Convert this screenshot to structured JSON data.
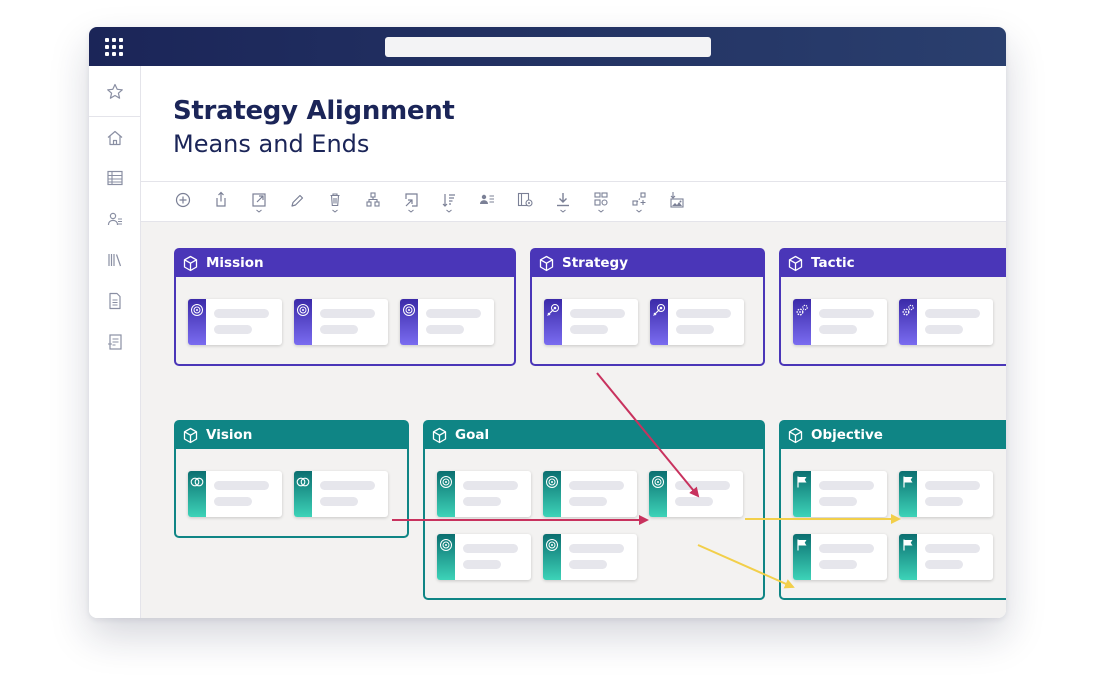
{
  "app": {
    "title": "Strategy Alignment",
    "subtitle": "Means and Ends"
  },
  "sidebar": {
    "items": [
      {
        "icon": "star-icon"
      },
      {
        "icon": "home-icon"
      },
      {
        "icon": "table-icon"
      },
      {
        "icon": "users-icon"
      },
      {
        "icon": "library-icon"
      },
      {
        "icon": "document-icon"
      },
      {
        "icon": "report-icon"
      }
    ]
  },
  "toolbar": {
    "tools": [
      "add-icon",
      "share-icon",
      "open-external-icon",
      "edit-icon",
      "delete-icon",
      "hierarchy-icon",
      "link-icon",
      "sort-icon",
      "assign-users-icon",
      "settings-panel-icon",
      "download-icon",
      "layout-icon",
      "connect-icon",
      "image-export-icon"
    ]
  },
  "colors": {
    "purple": "#4a36b8",
    "teal": "#0f8585",
    "crimson_arrow": "#c8325e",
    "yellow_arrow": "#f2cf4a",
    "navy": "#1b2558"
  },
  "groups": {
    "mission": {
      "label": "Mission",
      "card_icon": "target-icon"
    },
    "strategy": {
      "label": "Strategy",
      "card_icon": "rocket-target-icon"
    },
    "tactic": {
      "label": "Tactic",
      "card_icon": "gears-icon"
    },
    "vision": {
      "label": "Vision",
      "card_icon": "overlap-circles-icon"
    },
    "goal": {
      "label": "Goal",
      "card_icon": "target-icon"
    },
    "objective": {
      "label": "Objective",
      "card_icon": "flag-icon"
    }
  }
}
